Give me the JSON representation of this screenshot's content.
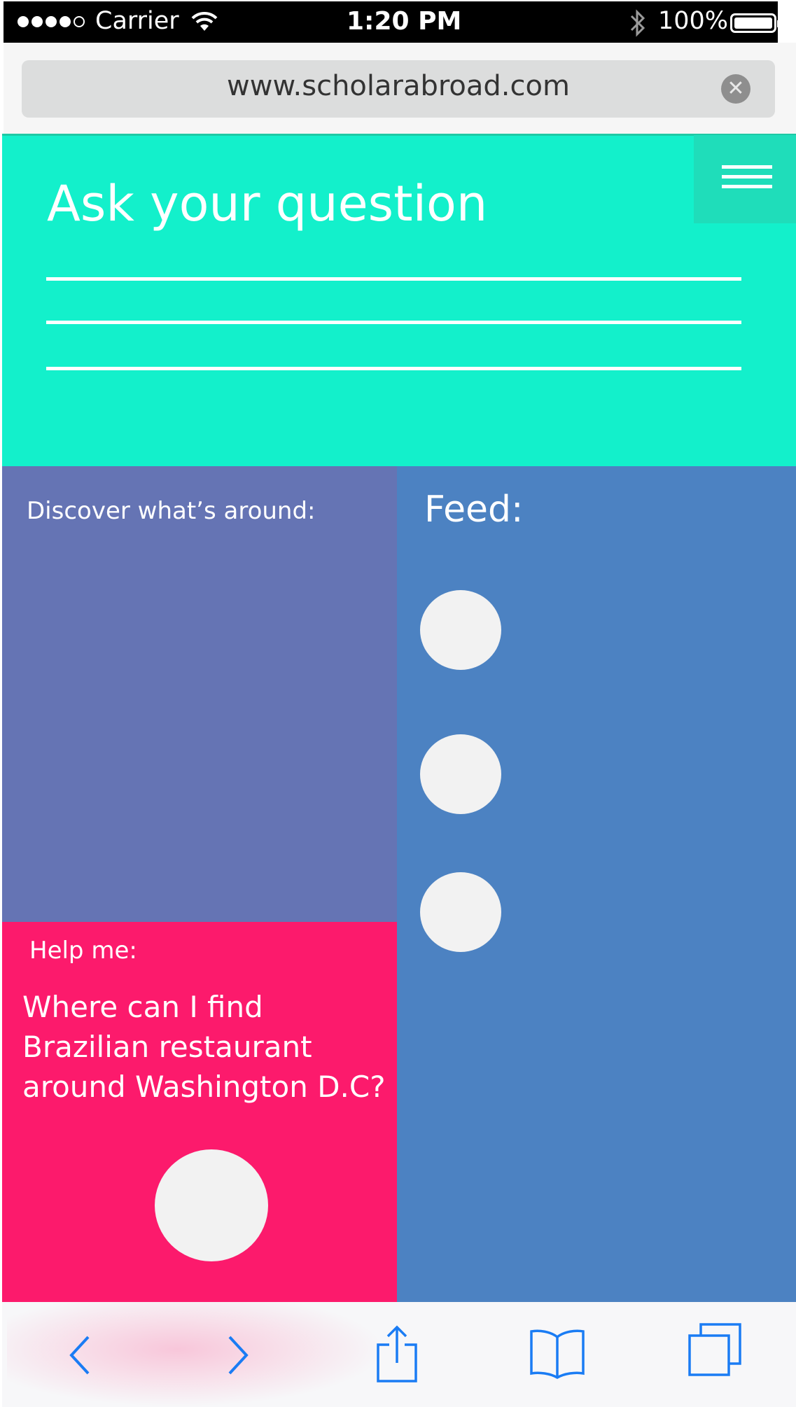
{
  "status_bar": {
    "carrier": "Carrier",
    "time": "1:20 PM",
    "battery": "100%",
    "signal_bars_filled": 4,
    "signal_bars_total": 5
  },
  "browser": {
    "url": "www.scholarabroad.com",
    "clear_icon": "clear-url-icon"
  },
  "ask": {
    "title": "Ask your question",
    "menu_icon": "hamburger-menu-icon",
    "answer_lines": 3
  },
  "discover": {
    "label": "Discover what’s around:"
  },
  "feed": {
    "label": "Feed:",
    "items": 3
  },
  "help": {
    "label": "Help me:",
    "question": "Where can I find Brazilian restaurant around Washington D.C?"
  },
  "toolbar": {
    "icons": [
      "back-icon",
      "forward-icon",
      "share-icon",
      "bookmarks-icon",
      "tabs-icon"
    ]
  },
  "colors": {
    "ask_bg": "#13f0cb",
    "discover_bg": "#6574b4",
    "feed_bg": "#4c82c2",
    "help_bg": "#fc1a6c",
    "toolbar_icon": "#1a7cf4"
  }
}
